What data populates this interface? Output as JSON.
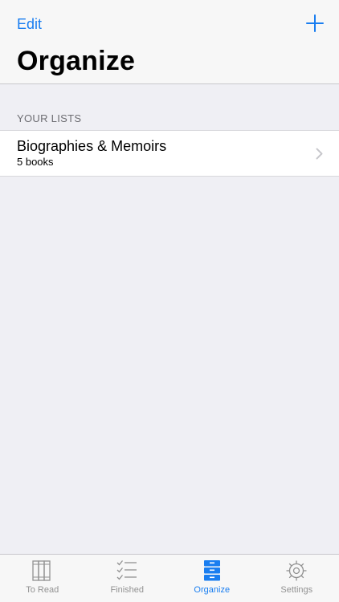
{
  "nav": {
    "edit_label": "Edit",
    "add_icon": "plus-icon",
    "title": "Organize"
  },
  "section": {
    "header": "YOUR LISTS"
  },
  "lists": [
    {
      "title": "Biographies & Memoirs",
      "subtitle": "5 books"
    }
  ],
  "tabs": [
    {
      "label": "To Read",
      "icon": "books-icon",
      "active": false
    },
    {
      "label": "Finished",
      "icon": "checklist-icon",
      "active": false
    },
    {
      "label": "Organize",
      "icon": "drawers-icon",
      "active": true
    },
    {
      "label": "Settings",
      "icon": "gear-icon",
      "active": false
    }
  ],
  "colors": {
    "accent": "#1a7ef0",
    "inactive": "#929292",
    "background": "#efeff4"
  }
}
